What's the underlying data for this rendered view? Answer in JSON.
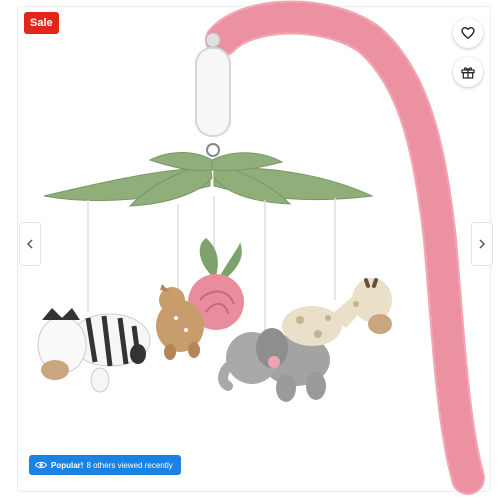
{
  "badge": {
    "sale": "Sale"
  },
  "popular": {
    "label": "Popular!",
    "text": "8 others viewed recently"
  },
  "icons": {
    "favorite": "heart-icon",
    "registry": "gift-icon",
    "prev": "chevron-left-icon",
    "next": "chevron-right-icon",
    "popular": "eye-icon"
  },
  "colors": {
    "sale": "#e1261c",
    "popular": "#1a82e2",
    "arm": "#f2a6b3",
    "leaves": "#8fae7a"
  }
}
